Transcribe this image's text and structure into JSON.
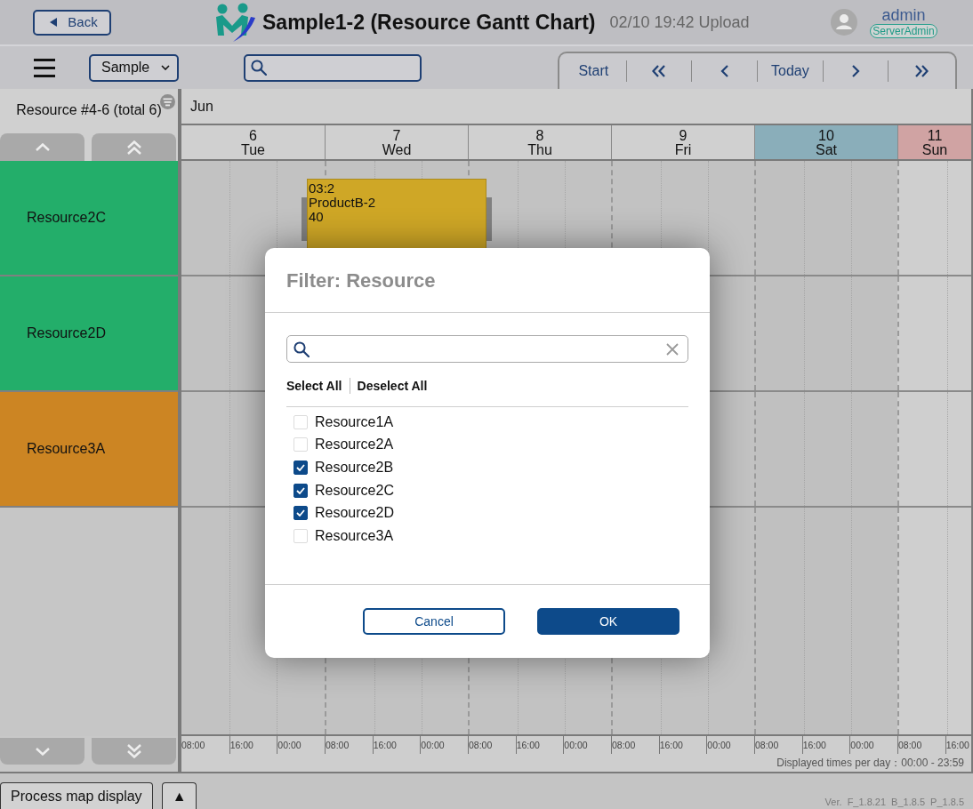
{
  "header": {
    "back": "Back",
    "title": "Sample1-2 (Resource Gantt Chart)",
    "upload_info": "02/10 19:42 Upload",
    "user": "admin",
    "role": "ServerAdmin"
  },
  "toolbar": {
    "view_select": "Sample",
    "nav_start": "Start",
    "nav_today": "Today"
  },
  "resource_panel": {
    "range": "Resource #4-6 (total 6)",
    "resources": [
      {
        "name": "Resource2C",
        "color": "#23ae6a",
        "tasks": [
          {
            "lines": [
              "03:2",
              "ProductB-2",
              "40"
            ]
          }
        ]
      },
      {
        "name": "Resource2D",
        "color": "#23ae6a"
      },
      {
        "name": "Resource3A",
        "color": "#cc8523"
      }
    ]
  },
  "timeline": {
    "month": "Jun",
    "days": [
      {
        "date": "6",
        "weekday": "Tue",
        "kind": "weekday",
        "ticks": [
          "08:00",
          "16:00",
          "00:00"
        ]
      },
      {
        "date": "7",
        "weekday": "Wed",
        "kind": "weekday",
        "ticks": [
          "08:00",
          "16:00",
          "00:00"
        ]
      },
      {
        "date": "8",
        "weekday": "Thu",
        "kind": "weekday",
        "ticks": [
          "08:00",
          "16:00",
          "00:00"
        ]
      },
      {
        "date": "9",
        "weekday": "Fri",
        "kind": "weekday",
        "ticks": [
          "08:00",
          "16:00",
          "00:00"
        ]
      },
      {
        "date": "10",
        "weekday": "Sat",
        "kind": "saturday",
        "ticks": [
          "08:00",
          "16:00",
          "00:00"
        ]
      },
      {
        "date": "11",
        "weekday": "Sun",
        "kind": "sunday",
        "ticks": [
          "08:00",
          "16:00"
        ]
      }
    ],
    "display_range": "Displayed times per day：00:00 - 23:59"
  },
  "footer": {
    "buttons": [
      "Process map display",
      "▲"
    ],
    "version": "Ver. F_1.8.21 B_1.8.5 P_1.8.5"
  },
  "dialog": {
    "title": "Filter: Resource",
    "select_all": "Select All",
    "deselect_all": "Deselect All",
    "items": [
      {
        "label": "Resource1A",
        "checked": false
      },
      {
        "label": "Resource2A",
        "checked": false
      },
      {
        "label": "Resource2B",
        "checked": true
      },
      {
        "label": "Resource2C",
        "checked": true
      },
      {
        "label": "Resource2D",
        "checked": true
      },
      {
        "label": "Resource3A",
        "checked": false
      }
    ],
    "buttons": [
      {
        "label": "Cancel",
        "kind": "secondary"
      },
      {
        "label": "OK",
        "kind": "primary"
      }
    ]
  }
}
